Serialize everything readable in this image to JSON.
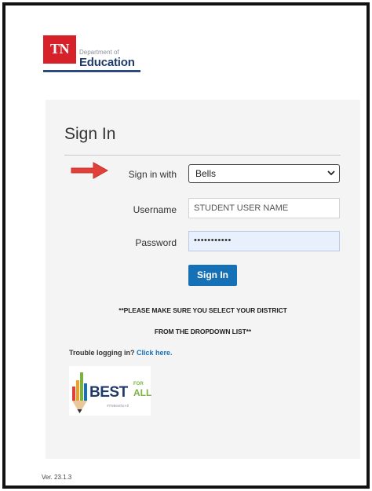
{
  "header": {
    "logo_badge": "TN",
    "department": "Department of",
    "education": "Education"
  },
  "panel": {
    "title": "Sign In",
    "sign_in_with_label": "Sign in with",
    "sign_in_with_value": "Bells",
    "username_label": "Username",
    "username_value": "STUDENT USER NAME",
    "password_label": "Password",
    "password_value": "•••••••••••",
    "sign_in_button": "Sign In",
    "notice_line_1": "**PLEASE MAKE SURE YOU SELECT YOUR DISTRICT",
    "notice_line_2": "FROM THE DROPDOWN LIST**",
    "trouble_text": "Trouble logging in?",
    "trouble_link": "Click here."
  },
  "best_logo": {
    "best": "BEST",
    "for": "FOR",
    "all": "ALL",
    "tagline": "#TNBestforAll"
  },
  "footer": {
    "version": "Ver. 23.1.3"
  },
  "colors": {
    "brand_red": "#d6202a",
    "brand_navy": "#1f3a6a",
    "button_blue": "#1670b6",
    "arrow_red": "#e0403a",
    "best_green": "#7bb342"
  },
  "icons": [
    "arrow-right-icon",
    "chevron-down-icon",
    "pencil-bars-icon"
  ]
}
